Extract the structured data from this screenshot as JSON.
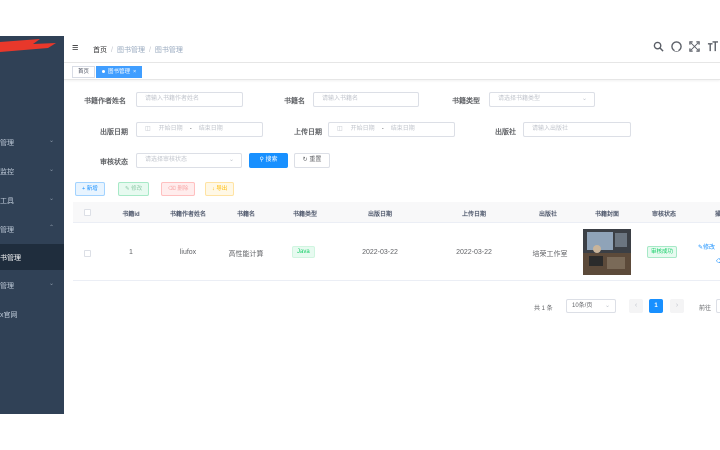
{
  "sidebar": {
    "items": [
      {
        "label": "管理",
        "has_children": true
      },
      {
        "label": "监控",
        "has_children": true
      },
      {
        "label": "工具",
        "has_children": true
      },
      {
        "label": "管理",
        "has_children": true
      },
      {
        "label": "书管理",
        "active": true
      },
      {
        "label": "管理",
        "has_children": true
      },
      {
        "label": "x官网"
      }
    ]
  },
  "navbar": {
    "breadcrumb": [
      "首页",
      "图书管理",
      "图书管理"
    ],
    "icons": [
      "search-icon",
      "github-icon",
      "fullscreen-icon",
      "font-size-icon"
    ]
  },
  "tags": [
    {
      "label": "首页",
      "active": false
    },
    {
      "label": "图书管理",
      "active": true
    }
  ],
  "search": {
    "author": {
      "label": "书籍作者姓名",
      "placeholder": "请输入书籍作者姓名"
    },
    "name": {
      "label": "书籍名",
      "placeholder": "请输入书籍名"
    },
    "type": {
      "label": "书籍类型",
      "placeholder": "请选择书籍类型"
    },
    "publish_date": {
      "label": "出版日期",
      "start": "开始日期",
      "end": "结束日期"
    },
    "upload_date": {
      "label": "上传日期",
      "start": "开始日期",
      "end": "结束日期"
    },
    "publisher": {
      "label": "出版社",
      "placeholder": "请输入出版社"
    },
    "status": {
      "label": "审核状态",
      "placeholder": "请选择审核状态"
    },
    "search_button": "搜索",
    "reset_button": "重置"
  },
  "toolbar": {
    "add": "新增",
    "edit": "修改",
    "delete": "删除",
    "export": "导出"
  },
  "table": {
    "columns": [
      "书籍id",
      "书籍作者姓名",
      "书籍名",
      "书籍类型",
      "出版日期",
      "上传日期",
      "出版社",
      "书籍封面",
      "审核状态",
      "操"
    ],
    "rows": [
      {
        "id": "1",
        "author": "liufox",
        "name": "高性能计算",
        "type": "Java",
        "publish_date": "2022-03-22",
        "upload_date": "2022-03-22",
        "publisher": "培荣工作室",
        "status": "审核成功",
        "actions": [
          "修改",
          "删"
        ]
      }
    ]
  },
  "pagination": {
    "total": "共 1 条",
    "page_size": "10条/页",
    "current_page": "1",
    "goto_label": "前往"
  },
  "colors": {
    "sidebar_bg": "#304156",
    "primary": "#1890ff",
    "success": "#13ce66",
    "logo_red": "#e8382b"
  }
}
